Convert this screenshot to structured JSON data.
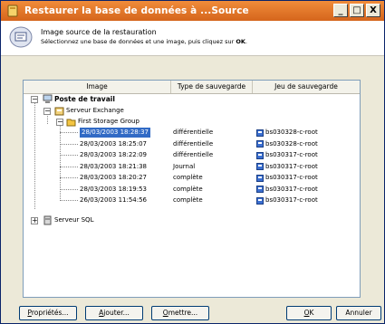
{
  "window": {
    "title": "Restaurer la base de données à ...Source",
    "minimize": "_",
    "maximize": "□",
    "close": "X"
  },
  "header": {
    "title": "Image source de la restauration",
    "subtitle_prefix": "Sélectionnez une base de données et une image, puis cliquez sur ",
    "subtitle_bold": "OK",
    "subtitle_suffix": "."
  },
  "columns": {
    "image": "Image",
    "type": "Type de sauvegarde",
    "set": "Jeu de sauvegarde"
  },
  "tree": {
    "root": "Poste de travail",
    "exchange": "Serveur Exchange",
    "storage_group": "First Storage Group",
    "sql": "Serveur SQL"
  },
  "images": [
    {
      "date": "28/03/2003 18:28:37",
      "type": "différentielle",
      "set": "bs030328-c-root",
      "selected": true
    },
    {
      "date": "28/03/2003 18:25:07",
      "type": "différentielle",
      "set": "bs030328-c-root"
    },
    {
      "date": "28/03/2003 18:22:09",
      "type": "différentielle",
      "set": "bs030317-c-root"
    },
    {
      "date": "28/03/2003 18:21:38",
      "type": "Journal",
      "set": "bs030317-c-root"
    },
    {
      "date": "28/03/2003 18:20:27",
      "type": "complète",
      "set": "bs030317-c-root"
    },
    {
      "date": "28/03/2003 18:19:53",
      "type": "complète",
      "set": "bs030317-c-root"
    },
    {
      "date": "26/03/2003 11:54:56",
      "type": "complète",
      "set": "bs030317-c-root"
    }
  ],
  "buttons": {
    "properties_u": "P",
    "properties": "ropriétés...",
    "add_u": "A",
    "add": "jouter...",
    "omit_u": "O",
    "omit": "mettre...",
    "ok_u": "O",
    "ok": "K",
    "cancel": "Annuler"
  }
}
